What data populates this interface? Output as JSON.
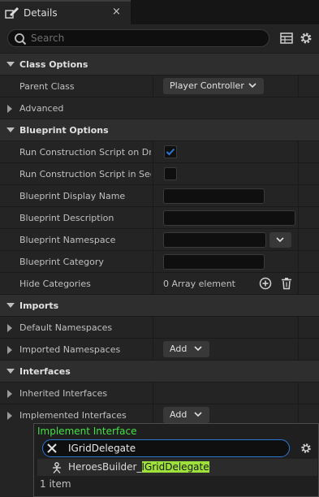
{
  "tab": {
    "title": "Details",
    "close_label": "×",
    "icon": "pencil-details-icon"
  },
  "search": {
    "placeholder": "Search",
    "value": ""
  },
  "toolbar": {
    "icons": [
      "table-view-icon",
      "settings-gear-icon"
    ]
  },
  "sections": {
    "class_options": "Class Options",
    "blueprint_options": "Blueprint Options",
    "imports": "Imports",
    "interfaces": "Interfaces"
  },
  "rows": {
    "parent_class": {
      "label": "Parent Class",
      "value": "Player Controller"
    },
    "advanced": {
      "label": "Advanced"
    },
    "run_on_drag": {
      "label": "Run Construction Script on Drag",
      "checked": true
    },
    "run_in_seq": {
      "label": "Run Construction Script in Seq...",
      "checked": false
    },
    "display_name": {
      "label": "Blueprint Display Name",
      "value": ""
    },
    "description": {
      "label": "Blueprint Description",
      "value": ""
    },
    "namespace": {
      "label": "Blueprint Namespace",
      "value": ""
    },
    "category": {
      "label": "Blueprint Category",
      "value": ""
    },
    "hide_categories": {
      "label": "Hide Categories",
      "value": "0 Array element"
    },
    "default_namespaces": {
      "label": "Default Namespaces"
    },
    "imported_namespaces": {
      "label": "Imported Namespaces",
      "button": "Add"
    },
    "inherited_interfaces": {
      "label": "Inherited Interfaces"
    },
    "implemented_interfaces": {
      "label": "Implemented Interfaces",
      "button": "Add"
    }
  },
  "popup": {
    "title": "Implement Interface",
    "search_value": "IGridDelegate",
    "result_prefix": "HeroesBuilder_",
    "result_match": "IGridDelegate",
    "count": "1 item"
  },
  "colors": {
    "accent_blue": "#2a78d4",
    "highlight": "#9ee13b",
    "popup_title": "#45e045"
  }
}
